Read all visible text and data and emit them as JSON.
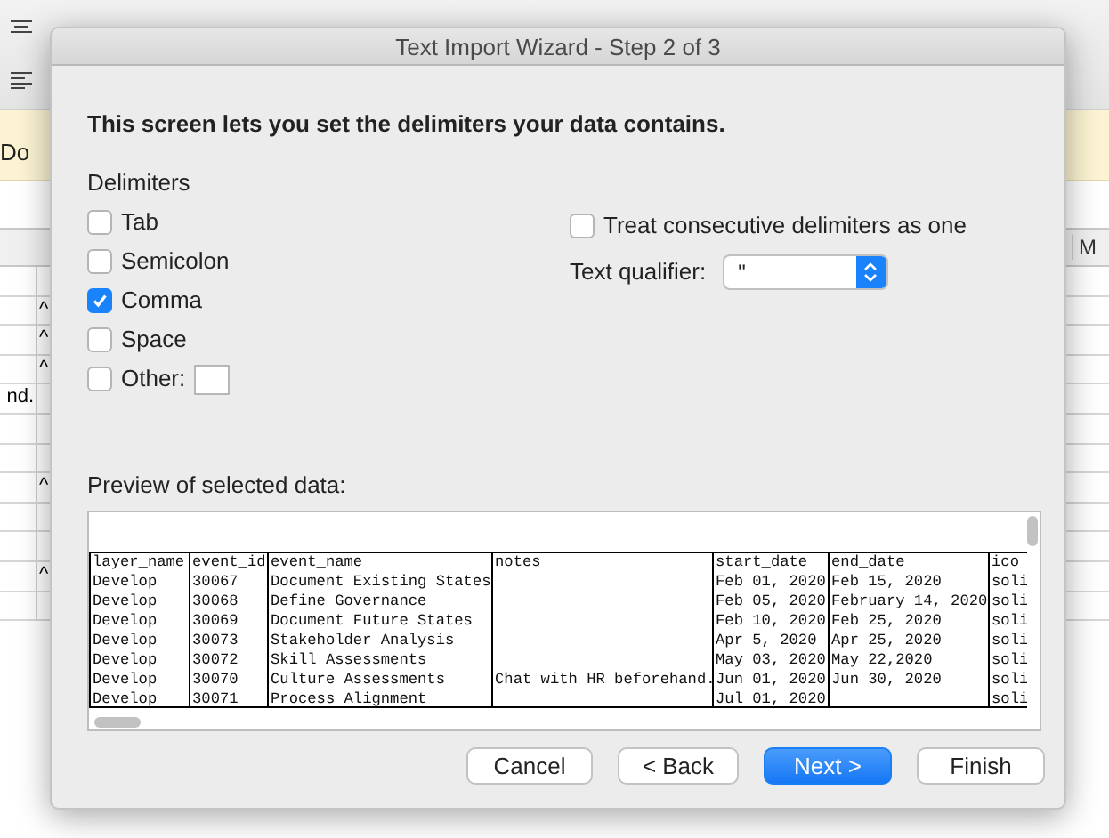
{
  "background": {
    "banner": "Do",
    "column_header": "M",
    "rows": [
      {
        "a": null,
        "b": null
      },
      {
        "a": null,
        "b": "^"
      },
      {
        "a": null,
        "b": "^"
      },
      {
        "a": null,
        "b": "^"
      },
      {
        "a": "nd.",
        "b": null
      },
      {
        "a": null,
        "b": null
      },
      {
        "a": null,
        "b": null
      },
      {
        "a": null,
        "b": "^"
      },
      {
        "a": null,
        "b": null
      },
      {
        "a": null,
        "b": null
      },
      {
        "a": null,
        "b": "^"
      },
      {
        "a": null,
        "b": null
      }
    ]
  },
  "dialog": {
    "title": "Text Import Wizard - Step 2 of 3",
    "instruction": "This screen lets you set the delimiters your data contains.",
    "delimiters_label": "Delimiters",
    "delimiters": [
      {
        "label": "Tab",
        "checked": false
      },
      {
        "label": "Semicolon",
        "checked": false
      },
      {
        "label": "Comma",
        "checked": true
      },
      {
        "label": "Space",
        "checked": false
      }
    ],
    "other": {
      "label": "Other:",
      "checked": false
    },
    "consecutive": {
      "label": "Treat consecutive delimiters as one",
      "checked": false
    },
    "qualifier": {
      "label": "Text qualifier:",
      "value": "\""
    },
    "preview": {
      "label": "Preview of selected data:",
      "columns": [
        "layer_name",
        "event_id",
        "event_name",
        "notes",
        "start_date",
        "end_date",
        "ico"
      ],
      "rows": [
        [
          "Develop",
          "30067",
          "Document Existing States",
          null,
          "Feb 01, 2020",
          "Feb 15, 2020",
          "soli"
        ],
        [
          "Develop",
          "30068",
          "Define Governance",
          null,
          "Feb 05, 2020",
          "February 14, 2020",
          "soli"
        ],
        [
          "Develop",
          "30069",
          "Document Future States",
          null,
          "Feb 10, 2020",
          "Feb 25, 2020",
          "soli"
        ],
        [
          "Develop",
          "30073",
          "Stakeholder Analysis",
          null,
          "Apr 5, 2020",
          "Apr 25, 2020",
          "soli"
        ],
        [
          "Develop",
          "30072",
          "Skill Assessments",
          null,
          "May 03, 2020",
          "May 22,2020",
          "soli"
        ],
        [
          "Develop",
          "30070",
          "Culture Assessments",
          "Chat with HR beforehand.",
          "Jun 01, 2020",
          "Jun 30, 2020",
          "soli"
        ],
        [
          "Develop",
          "30071",
          "Process Alignment",
          null,
          "Jul 01, 2020",
          null,
          "soli"
        ]
      ]
    },
    "buttons": [
      {
        "label": "Cancel",
        "default": false
      },
      {
        "label": "< Back",
        "default": false
      },
      {
        "label": "Next >",
        "default": true
      },
      {
        "label": "Finish",
        "default": false
      }
    ]
  }
}
